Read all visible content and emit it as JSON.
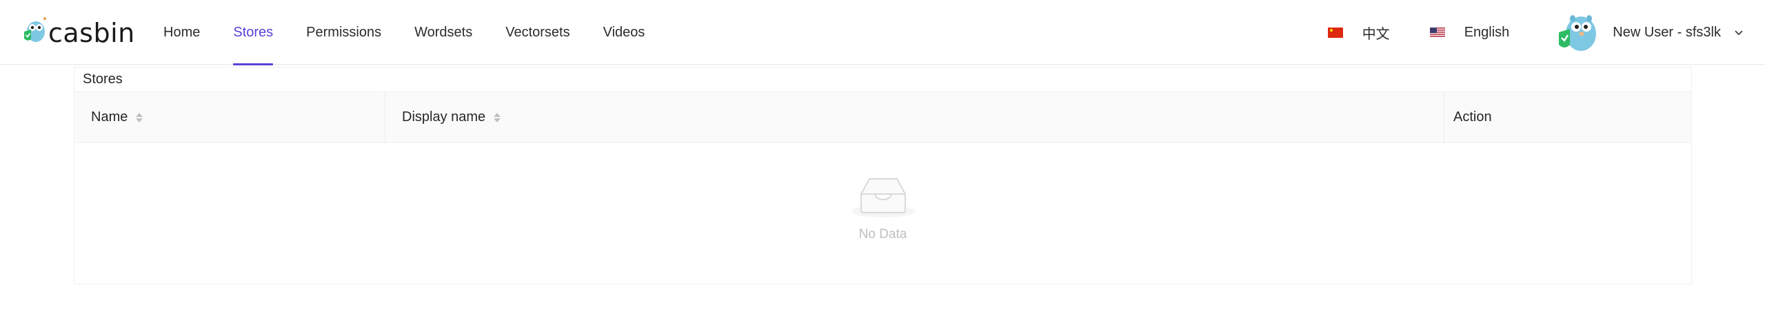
{
  "header": {
    "logo_text": "casbin",
    "nav": [
      {
        "label": "Home",
        "active": false
      },
      {
        "label": "Stores",
        "active": true
      },
      {
        "label": "Permissions",
        "active": false
      },
      {
        "label": "Wordsets",
        "active": false
      },
      {
        "label": "Vectorsets",
        "active": false
      },
      {
        "label": "Videos",
        "active": false
      }
    ],
    "languages": [
      {
        "label": "中文",
        "flag": "cn-flag-icon"
      },
      {
        "label": "English",
        "flag": "us-flag-icon"
      }
    ],
    "user": {
      "name": "New User - sfs3lk",
      "avatar_icon": "gopher-avatar-icon"
    }
  },
  "main": {
    "card_title": "Stores",
    "table": {
      "columns": [
        {
          "label": "Name",
          "sortable": true
        },
        {
          "label": "Display name",
          "sortable": true
        },
        {
          "label": "Action",
          "sortable": false
        }
      ],
      "rows": [],
      "empty_text": "No Data"
    }
  },
  "colors": {
    "accent": "#5b3fd6",
    "header_bg": "#ffffff",
    "table_header_bg": "#fafafa",
    "empty_text": "#bfbfbf"
  }
}
